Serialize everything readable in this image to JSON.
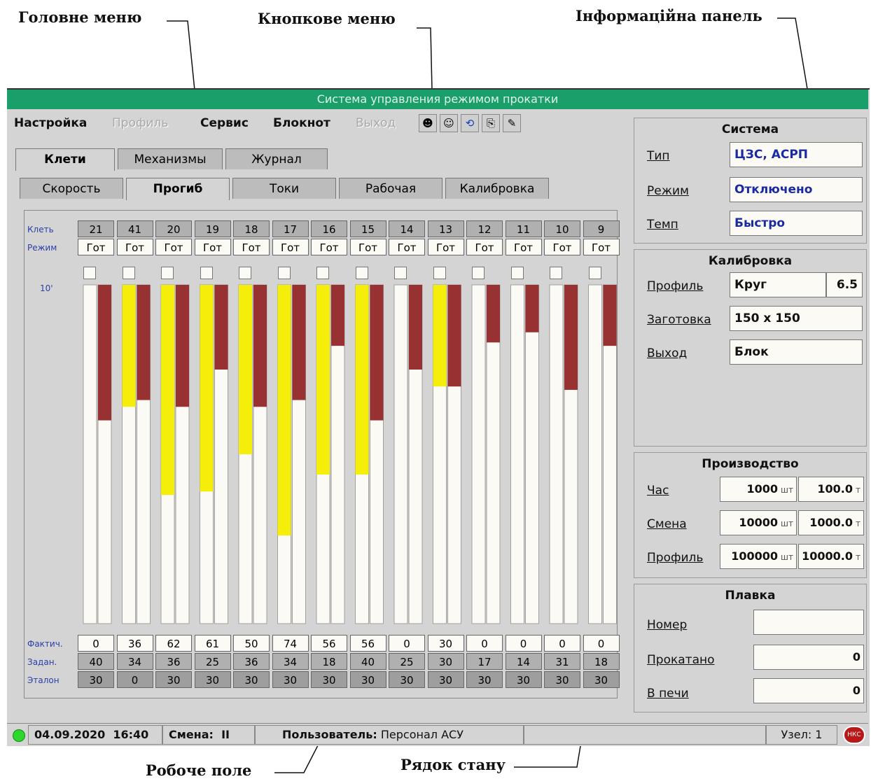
{
  "annotations": {
    "main_menu": "Головне меню",
    "button_menu": "Кнопкове меню",
    "info_panel": "Інформаційна панель",
    "work_field": "Робоче поле",
    "status_line": "Рядок стану"
  },
  "window": {
    "title": "Система управления режимом прокатки"
  },
  "menu": {
    "nastroika": "Настройка",
    "profil": "Профиль",
    "servis": "Сервис",
    "bloknot": "Блокнот",
    "vyhod": "Выход"
  },
  "toolbar_icons": [
    "user-icon",
    "users-icon",
    "refresh-icon",
    "document-up-icon",
    "document-edit-icon"
  ],
  "tabs_top": [
    "Клети",
    "Механизмы",
    "Журнал"
  ],
  "tabs_sub": [
    "Скорость",
    "Прогиб",
    "Токи",
    "Рабочая",
    "Калибровка"
  ],
  "row_labels": {
    "klet": "Клеть",
    "rezhim": "Режим",
    "scale": "10'",
    "fakt": "Фактич.",
    "zadan": "Задан.",
    "etalon": "Эталон"
  },
  "stands": [
    "21",
    "41",
    "20",
    "19",
    "18",
    "17",
    "16",
    "15",
    "14",
    "13",
    "12",
    "11",
    "10",
    "9"
  ],
  "modes": [
    "Гот",
    "Гот",
    "Гот",
    "Гот",
    "Гот",
    "Гот",
    "Гот",
    "Гот",
    "Гот",
    "Гот",
    "Гот",
    "Гот",
    "Гот",
    "Гот"
  ],
  "actual": [
    "0",
    "36",
    "62",
    "61",
    "50",
    "74",
    "56",
    "56",
    "0",
    "30",
    "0",
    "0",
    "0",
    "0"
  ],
  "setpoint": [
    "40",
    "34",
    "36",
    "25",
    "36",
    "34",
    "18",
    "40",
    "25",
    "30",
    "17",
    "14",
    "31",
    "18"
  ],
  "reference": [
    "30",
    "0",
    "30",
    "30",
    "30",
    "30",
    "30",
    "30",
    "30",
    "30",
    "30",
    "30",
    "30",
    "30"
  ],
  "colors": {
    "actual_bar": "#f5ee0a",
    "setpoint_bar": "#983232",
    "bar_bg": "#fbfaf4",
    "titlebar": "#1a9f6b",
    "value_text": "#1a2aa0"
  },
  "system": {
    "title": "Система",
    "type_label": "Тип",
    "type_value": "ЦЗС, АСРП",
    "mode_label": "Режим",
    "mode_value": "Отключено",
    "tempo_label": "Темп",
    "tempo_value": "Быстро"
  },
  "calibration": {
    "title": "Калибровка",
    "profile_label": "Профиль",
    "profile_value": "Круг",
    "profile_size": "6.5",
    "billet_label": "Заготовка",
    "billet_value": "150 x 150",
    "output_label": "Выход",
    "output_value": "Блок"
  },
  "production": {
    "title": "Производство",
    "unit_pcs": "шт",
    "unit_t": "т",
    "rows": [
      {
        "label": "Час",
        "pcs": "1000",
        "tons": "100.0"
      },
      {
        "label": "Смена",
        "pcs": "10000",
        "tons": "1000.0"
      },
      {
        "label": "Профиль",
        "pcs": "100000",
        "tons": "10000.0"
      }
    ]
  },
  "heat": {
    "title": "Плавка",
    "number_label": "Номер",
    "number_value": "",
    "rolled_label": "Прокатано",
    "rolled_value": "0",
    "furnace_label": "В печи",
    "furnace_value": "0"
  },
  "status": {
    "date": "04.09.2020",
    "time": "16:40",
    "shift_label": "Смена:",
    "shift_value": "II",
    "user_label": "Пользователь:",
    "user_value": "Персонал АСУ",
    "node": "Узел: 1",
    "logo_text": "НКС"
  }
}
